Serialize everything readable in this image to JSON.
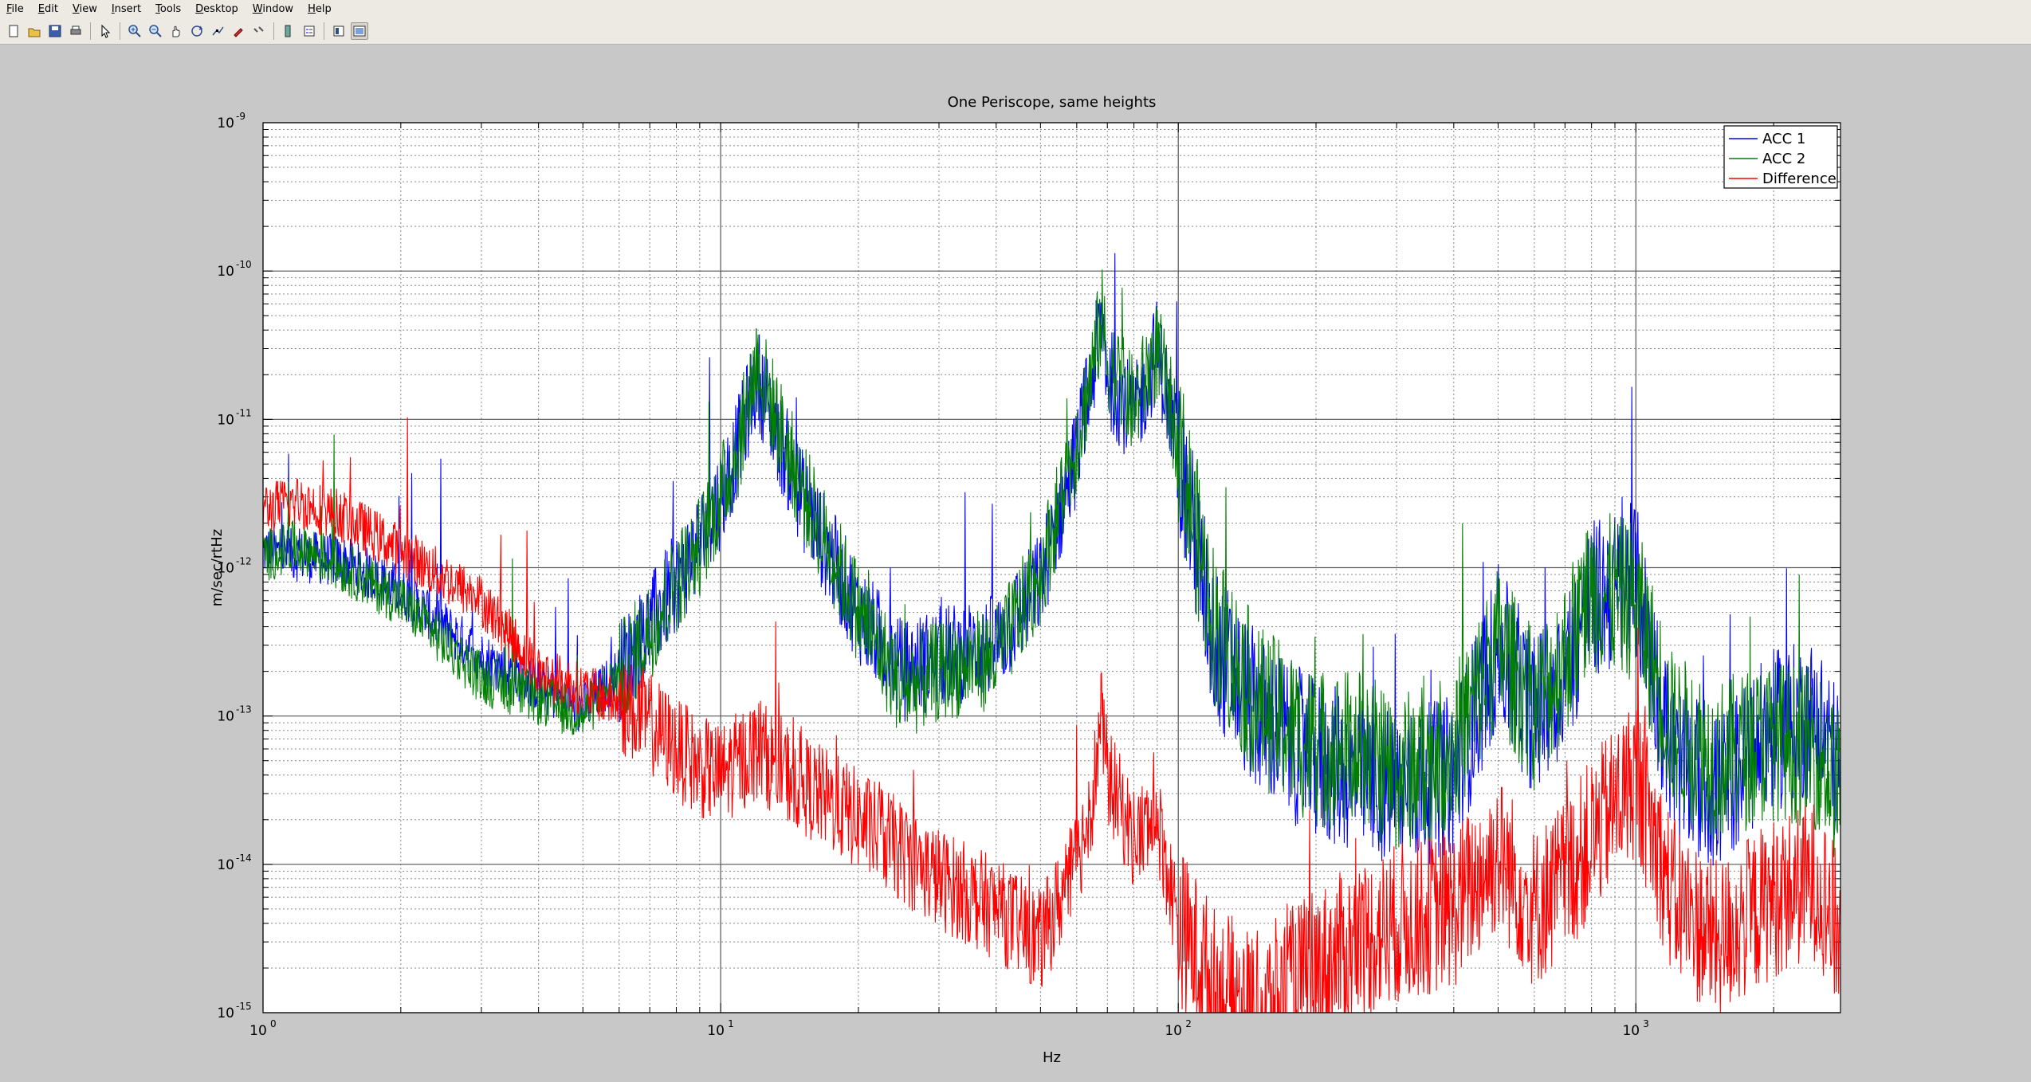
{
  "menu": [
    "File",
    "Edit",
    "View",
    "Insert",
    "Tools",
    "Desktop",
    "Window",
    "Help"
  ],
  "toolbar": {
    "icons": [
      "new-figure-icon",
      "open-file-icon",
      "save-figure-icon",
      "print-figure-icon",
      "edit-plot-icon",
      "zoom-in-icon",
      "zoom-out-icon",
      "pan-icon",
      "rotate-3d-icon",
      "data-cursor-icon",
      "brush-icon",
      "link-plot-icon",
      "insert-colorbar-icon",
      "insert-legend-icon",
      "hide-plot-tools-icon",
      "show-plot-tools-icon"
    ]
  },
  "chart_data": {
    "type": "line",
    "title": "One Periscope, same heights",
    "xlabel": "Hz",
    "ylabel": "m/sec/rtHz",
    "xscale": "log",
    "yscale": "log",
    "xlim": [
      1,
      2800
    ],
    "ylim": [
      1e-15,
      1e-09
    ],
    "grid": true,
    "legend_position": "top-right",
    "x_ticks": [
      {
        "base": "10",
        "exp": "0"
      },
      {
        "base": "10",
        "exp": "1"
      },
      {
        "base": "10",
        "exp": "2"
      },
      {
        "base": "10",
        "exp": "3"
      }
    ],
    "y_ticks": [
      {
        "base": "10",
        "exp": "-9"
      },
      {
        "base": "10",
        "exp": "-10"
      },
      {
        "base": "10",
        "exp": "-11"
      },
      {
        "base": "10",
        "exp": "-12"
      },
      {
        "base": "10",
        "exp": "-13"
      },
      {
        "base": "10",
        "exp": "-14"
      },
      {
        "base": "10",
        "exp": "-15"
      }
    ],
    "series": [
      {
        "name": "ACC 1",
        "color": "#0000ff",
        "x": [
          1,
          1.2,
          1.5,
          2,
          3,
          4,
          5,
          6,
          7,
          8,
          9,
          10,
          11,
          12,
          13,
          15,
          20,
          25,
          30,
          40,
          50,
          60,
          65,
          68,
          70,
          80,
          90,
          100,
          120,
          150,
          200,
          250,
          300,
          400,
          500,
          600,
          700,
          800,
          1000,
          1200,
          1500,
          2000,
          2500,
          2800
        ],
        "y": [
          1.3e-12,
          1.2e-12,
          1.1e-12,
          7e-13,
          2.5e-13,
          1.6e-13,
          1.1e-13,
          2e-13,
          4e-13,
          8e-13,
          1.5e-12,
          3e-12,
          7e-12,
          2e-11,
          1e-11,
          3e-12,
          5e-13,
          2e-13,
          2.5e-13,
          3e-13,
          8e-13,
          6e-12,
          2e-11,
          5e-11,
          2e-11,
          1e-11,
          3e-11,
          6e-12,
          3e-13,
          1e-13,
          5e-14,
          4e-14,
          3e-14,
          4e-14,
          3e-13,
          1e-13,
          2e-13,
          6e-13,
          8e-13,
          5e-14,
          3e-14,
          8e-14,
          1e-13,
          4e-14
        ]
      },
      {
        "name": "ACC 2",
        "color": "#007f00",
        "x": [
          1,
          1.2,
          1.5,
          2,
          3,
          4,
          5,
          6,
          7,
          8,
          9,
          10,
          11,
          12,
          13,
          15,
          20,
          25,
          30,
          40,
          50,
          60,
          65,
          68,
          70,
          80,
          90,
          100,
          120,
          150,
          200,
          250,
          300,
          400,
          500,
          600,
          700,
          800,
          1000,
          1200,
          1500,
          2000,
          2500,
          2800
        ],
        "y": [
          1.2e-12,
          1.4e-12,
          1e-12,
          6e-13,
          1.8e-13,
          1.3e-13,
          1e-13,
          1.9e-13,
          3.8e-13,
          8e-13,
          1.4e-12,
          3e-12,
          7e-12,
          2.5e-11,
          1.2e-11,
          3.5e-12,
          5e-13,
          1.5e-13,
          2e-13,
          2.5e-13,
          9e-13,
          7e-12,
          2.2e-11,
          5e-11,
          2.5e-11,
          1.2e-11,
          3e-11,
          7e-12,
          4e-13,
          1.2e-13,
          6e-14,
          6e-14,
          4e-14,
          6e-14,
          3e-13,
          1.1e-13,
          2.5e-13,
          7e-13,
          6e-13,
          8e-14,
          5e-14,
          7e-14,
          6e-14,
          3e-14
        ]
      },
      {
        "name": "Difference",
        "color": "#ff0000",
        "x": [
          1,
          1.2,
          1.5,
          2,
          3,
          4,
          5,
          6,
          7,
          8,
          9,
          10,
          12,
          15,
          20,
          25,
          30,
          40,
          50,
          60,
          65,
          68,
          70,
          80,
          90,
          100,
          120,
          150,
          200,
          250,
          300,
          400,
          500,
          600,
          700,
          800,
          1000,
          1200,
          1500,
          2000,
          2500,
          2800
        ],
        "y": [
          2.5e-12,
          2.8e-12,
          2.2e-12,
          1.3e-12,
          6e-13,
          2e-13,
          1.5e-13,
          1.2e-13,
          9e-14,
          6e-14,
          4.5e-14,
          4e-14,
          6e-14,
          3.5e-14,
          2e-14,
          1.2e-14,
          8e-15,
          5e-15,
          3e-15,
          1e-14,
          3e-14,
          1e-13,
          4e-14,
          1.5e-14,
          2e-14,
          4e-15,
          1.5e-15,
          1e-15,
          2e-15,
          3e-15,
          4e-15,
          5e-15,
          1.2e-14,
          5e-15,
          8e-15,
          1.5e-14,
          4e-14,
          6e-15,
          3e-15,
          6e-15,
          8e-15,
          3e-15
        ]
      }
    ]
  }
}
